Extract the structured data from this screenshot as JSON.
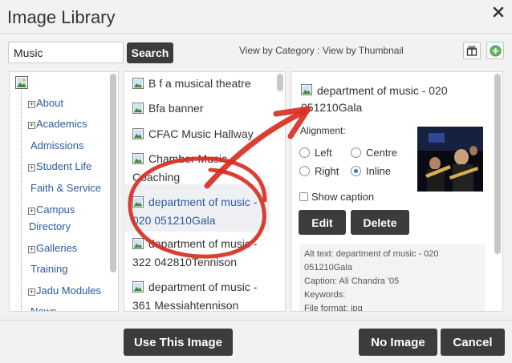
{
  "dialog": {
    "title": "Image Library"
  },
  "search": {
    "value": "Music",
    "button_label": "Search"
  },
  "view": {
    "by_category": "View by Category",
    "separator": " : ",
    "by_thumbnail": "View by Thumbnail"
  },
  "tree": {
    "items": [
      {
        "label": "About",
        "expandable": true
      },
      {
        "label": "Academics",
        "expandable": true
      },
      {
        "label": "Admissions",
        "expandable": false
      },
      {
        "label": "Student Life",
        "expandable": true
      },
      {
        "label": "Faith & Service",
        "expandable": false
      },
      {
        "label": "Campus",
        "expandable": true
      },
      {
        "label": "Directory",
        "expandable": false
      },
      {
        "label": "Galleries",
        "expandable": true
      },
      {
        "label": "Training",
        "expandable": false
      },
      {
        "label": "Jadu Modules",
        "expandable": true
      },
      {
        "label": "News",
        "expandable": false
      }
    ]
  },
  "list": {
    "items": [
      {
        "line1": "B f a musical theatre",
        "line2": ""
      },
      {
        "line1": "Bfa banner",
        "line2": ""
      },
      {
        "line1": "CFAC Music Hallway",
        "line2": ""
      },
      {
        "line1": "Chamber Music",
        "line2": "Coaching"
      },
      {
        "line1": "department of music -",
        "line2": "020 051210Gala"
      },
      {
        "line1": "department of music -",
        "line2": "322 042810Tennison"
      },
      {
        "line1": "department of music -",
        "line2": "361 Messiahtennison"
      }
    ]
  },
  "detail": {
    "title_line1": "department of music - 020",
    "title_line2": "051210Gala",
    "alignment_label": "Alignment:",
    "options": {
      "left": "Left",
      "centre": "Centre",
      "right": "Right",
      "inline": "Inline"
    },
    "selected_alignment": "Inline",
    "show_caption_label": "Show caption",
    "edit_label": "Edit",
    "delete_label": "Delete",
    "meta": {
      "alt_text_line1": "Alt text: department of music - 020",
      "alt_text_line2": "051210Gala",
      "caption": "Caption: Ali Chandra '05",
      "keywords": "Keywords:",
      "file_format": "File format: jpg"
    }
  },
  "footer": {
    "use_label": "Use This Image",
    "no_image_label": "No Image",
    "cancel_label": "Cancel"
  },
  "colors": {
    "button_dark": "#3c3c3c",
    "link_blue": "#2d5aa0",
    "annotation_red": "#d62a1e"
  }
}
